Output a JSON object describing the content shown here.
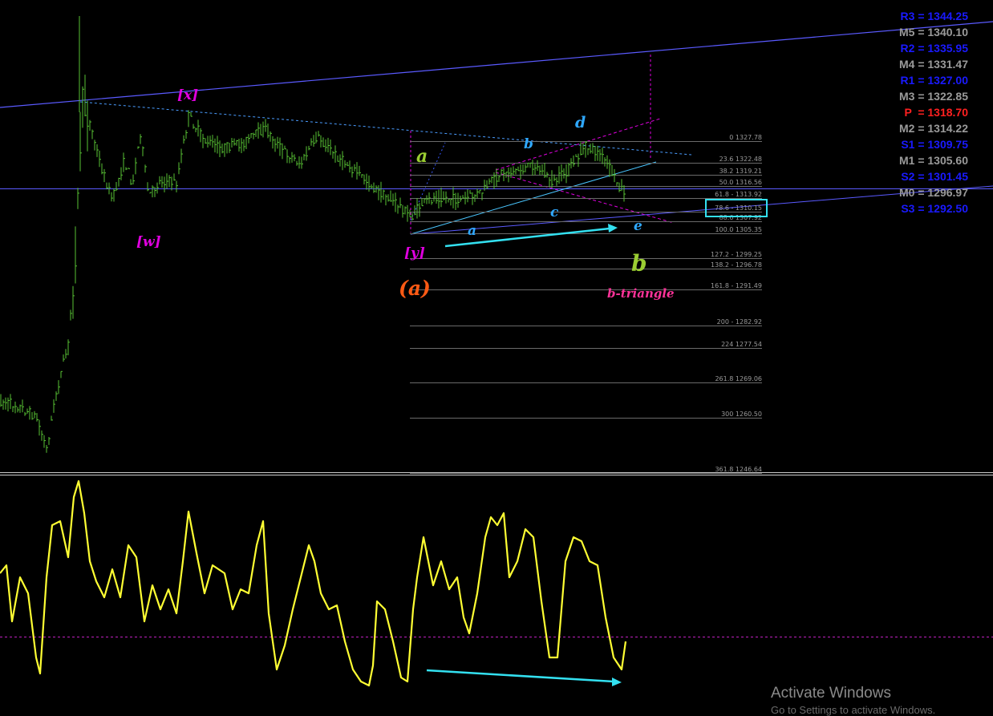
{
  "pivots": [
    {
      "label": "R3 = 1344.25",
      "color": "#1a1aff"
    },
    {
      "label": "M5 = 1340.10",
      "color": "#9a9a9a"
    },
    {
      "label": "R2 = 1335.95",
      "color": "#1a1aff"
    },
    {
      "label": "M4 = 1331.47",
      "color": "#9a9a9a"
    },
    {
      "label": "R1 = 1327.00",
      "color": "#1a1aff"
    },
    {
      "label": "M3 = 1322.85",
      "color": "#9a9a9a"
    },
    {
      "label": "P  = 1318.70",
      "color": "#ff2020"
    },
    {
      "label": "M2 = 1314.22",
      "color": "#9a9a9a"
    },
    {
      "label": "S1 = 1309.75",
      "color": "#1a1aff"
    },
    {
      "label": "M1 = 1305.60",
      "color": "#9a9a9a"
    },
    {
      "label": "S2 = 1301.45",
      "color": "#1a1aff"
    },
    {
      "label": "M0 = 1296.97",
      "color": "#9a9a9a"
    },
    {
      "label": "S3 = 1292.50",
      "color": "#1a1aff"
    }
  ],
  "fib_levels": [
    {
      "label": "0 1327.78"
    },
    {
      "label": "23.6 1322.48"
    },
    {
      "label": "38.2 1319.21"
    },
    {
      "label": "50.0 1316.56"
    },
    {
      "label": "61.8 - 1313.92"
    },
    {
      "label": "78.6 - 1310.15"
    },
    {
      "label": "88.6 1307.92"
    },
    {
      "label": "100.0 1305.35"
    },
    {
      "label": "127.2 - 1299.25"
    },
    {
      "label": "138.2 - 1296.78"
    },
    {
      "label": "161.8 - 1291.49"
    },
    {
      "label": "200 - 1282.92"
    },
    {
      "label": "224 1277.54"
    },
    {
      "label": "261.8 1269.06"
    },
    {
      "label": "300 1260.50"
    },
    {
      "label": "361.8 1246.64"
    }
  ],
  "wave_labels": {
    "w": "[w]",
    "x": "[x]",
    "y": "[y]",
    "big_a": "(a)",
    "a_green": "a",
    "b_green": "b",
    "a_small": "a",
    "b_small": "b",
    "c_small": "c",
    "d_small": "d",
    "e_small": "e",
    "triangle": "b-triangle"
  },
  "colors": {
    "candle": "#58c234",
    "oscillator": "#ffff33",
    "trendline": "#5a5aff",
    "cyan": "#33e0f0",
    "magenta": "#e000e0",
    "pink": "#ff3399",
    "orange": "#ff5a14",
    "lime": "#9acd32"
  },
  "watermark": {
    "title": "Activate Windows",
    "subtitle": "Go to Settings to activate Windows."
  }
}
